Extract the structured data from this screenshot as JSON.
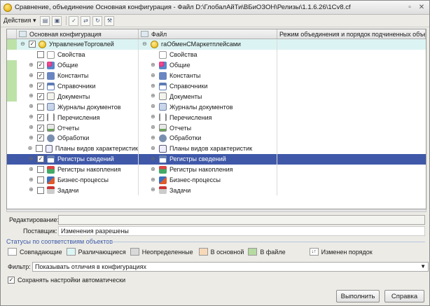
{
  "window": {
    "title": "Сравнение, объединение Основная конфигурация - Файл D:\\ГлобалАйТи\\ВБиОЗОН\\Релизы\\1.1.6.26\\1Cv8.cf"
  },
  "toolbar": {
    "actions_label": "Действия"
  },
  "grid": {
    "headers": {
      "main": "Основная конфигурация",
      "file": "Файл",
      "mode": "Режим объединения и порядок подчиненных объе..."
    },
    "rows": [
      {
        "main": "УправлениеТорговлей",
        "file": "гаОбменСМаркетплейсами",
        "main_icon": "config-root-icon",
        "file_icon": "config-root-icon",
        "checked": true,
        "toggle": "−",
        "level": 0
      },
      {
        "main": "Свойства",
        "file": "Свойства",
        "main_icon": "properties-icon",
        "file_icon": "properties-icon",
        "checked": false,
        "toggle": "",
        "level": 1
      },
      {
        "main": "Общие",
        "file": "Общие",
        "main_icon": "common-icon",
        "file_icon": "common-icon",
        "checked": true,
        "toggle": "+",
        "level": 1
      },
      {
        "main": "Константы",
        "file": "Константы",
        "main_icon": "constants-icon",
        "file_icon": "constants-icon",
        "checked": true,
        "toggle": "+",
        "level": 1
      },
      {
        "main": "Справочники",
        "file": "Справочники",
        "main_icon": "catalogs-icon",
        "file_icon": "catalogs-icon",
        "checked": true,
        "toggle": "+",
        "level": 1
      },
      {
        "main": "Документы",
        "file": "Документы",
        "main_icon": "documents-icon",
        "file_icon": "documents-icon",
        "checked": true,
        "toggle": "+",
        "level": 1
      },
      {
        "main": "Журналы документов",
        "file": "Журналы документов",
        "main_icon": "journals-icon",
        "file_icon": "journals-icon",
        "checked": null,
        "toggle": "+",
        "level": 1
      },
      {
        "main": "Перечисления",
        "file": "Перечисления",
        "main_icon": "enums-icon",
        "file_icon": "enums-icon",
        "checked": true,
        "toggle": "+",
        "level": 1
      },
      {
        "main": "Отчеты",
        "file": "Отчеты",
        "main_icon": "reports-icon",
        "file_icon": "reports-icon",
        "checked": true,
        "toggle": "+",
        "level": 1
      },
      {
        "main": "Обработки",
        "file": "Обработки",
        "main_icon": "processors-icon",
        "file_icon": "processors-icon",
        "checked": true,
        "toggle": "+",
        "level": 1
      },
      {
        "main": "Планы видов характеристик",
        "file": "Планы видов характеристик",
        "main_icon": "charts-of-characteristics-icon",
        "file_icon": "charts-of-characteristics-icon",
        "checked": null,
        "toggle": "+",
        "level": 1
      },
      {
        "main": "Регистры сведений",
        "file": "Регистры сведений",
        "main_icon": "information-registers-icon",
        "file_icon": "information-registers-icon",
        "checked": true,
        "toggle": "+",
        "level": 1
      },
      {
        "main": "Регистры накопления",
        "file": "Регистры накопления",
        "main_icon": "accumulation-registers-icon",
        "file_icon": "accumulation-registers-icon",
        "checked": null,
        "toggle": "+",
        "level": 1
      },
      {
        "main": "Бизнес-процессы",
        "file": "Бизнес-процессы",
        "main_icon": "business-processes-icon",
        "file_icon": "business-processes-icon",
        "checked": null,
        "toggle": "+",
        "level": 1
      },
      {
        "main": "Задачи",
        "file": "Задачи",
        "main_icon": "tasks-icon",
        "file_icon": "tasks-icon",
        "checked": null,
        "toggle": "+",
        "level": 1
      }
    ],
    "selected_row": "Регистры сведений"
  },
  "form": {
    "edit_label": "Редактирование:",
    "edit_value": "",
    "supplier_label": "Поставщик:",
    "supplier_value": "Изменения разрешены"
  },
  "statuses": {
    "title": "Статусы по соответствиям объектов",
    "items": [
      {
        "label": "Совпадающие",
        "color": "#ffffff"
      },
      {
        "label": "Различающиеся",
        "color": "#dcf6f6"
      },
      {
        "label": "Неопределенные",
        "color": "#d9d9d9"
      },
      {
        "label": "В основной",
        "color": "#f7d9b8"
      },
      {
        "label": "В файле",
        "color": "#b5dba0"
      }
    ],
    "order_changed": "Изменен порядок",
    "order_icon": "order-changed-icon"
  },
  "filter": {
    "label": "Фильтр:",
    "value": "Показывать отличия в конфигурациях"
  },
  "save_settings": {
    "label": "Сохранять настройки автоматически",
    "checked": true
  },
  "buttons": {
    "execute": "Выполнить",
    "help": "Справка"
  },
  "colors": {
    "selection": "#3f58a8",
    "highlight": "#dcf3f3",
    "in_file": "#bde2a8"
  }
}
